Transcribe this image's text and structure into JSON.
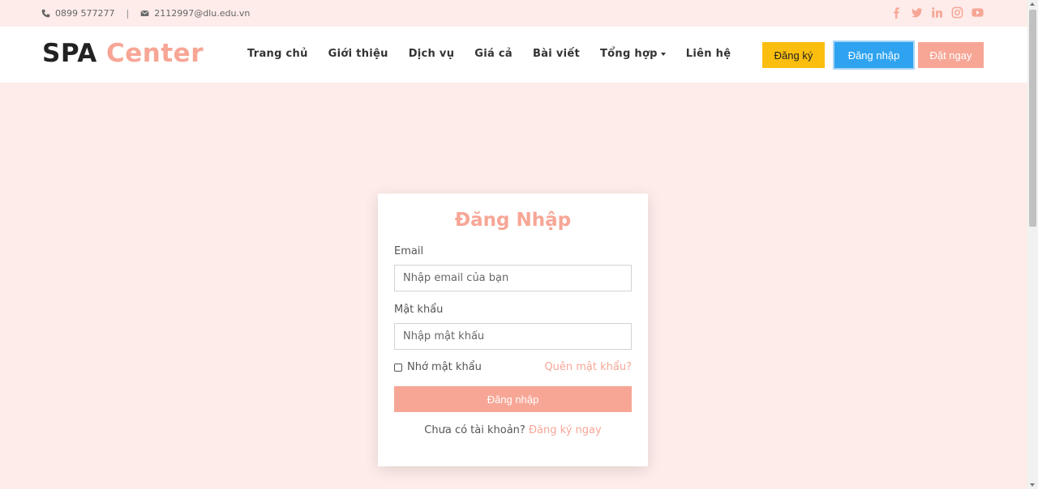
{
  "topbar": {
    "phone": "0899 577277",
    "separator": "|",
    "email": "2112997@dlu.edu.vn",
    "social_icons": [
      "facebook-icon",
      "twitter-icon",
      "linkedin-icon",
      "instagram-icon",
      "youtube-icon"
    ]
  },
  "header": {
    "logo_part1": "SPA",
    "logo_part2": "Center",
    "nav": [
      "Trang chủ",
      "Giới thiệu",
      "Dịch vụ",
      "Giá cả",
      "Bài viết",
      "Tổng hợp",
      "Liên hệ"
    ],
    "register_label": "Đăng ký",
    "login_label": "Đăng nhập",
    "book_label": "Đặt ngay"
  },
  "login_form": {
    "title": "Đăng Nhập",
    "email_label": "Email",
    "email_placeholder": "Nhập email của bạn",
    "password_label": "Mật khẩu",
    "password_placeholder": "Nhập mật khẩu",
    "remember_label": "Nhớ mật khẩu",
    "forgot_label": "Quên mật khẩu?",
    "submit_label": "Đăng nhập",
    "no_account_text": "Chưa có tài khoản?",
    "signup_link": "Đăng ký ngay"
  },
  "colors": {
    "accent": "#f7a696",
    "background": "#fdecea",
    "register_button": "#fbbe0f",
    "login_button": "#2fa3f0"
  }
}
